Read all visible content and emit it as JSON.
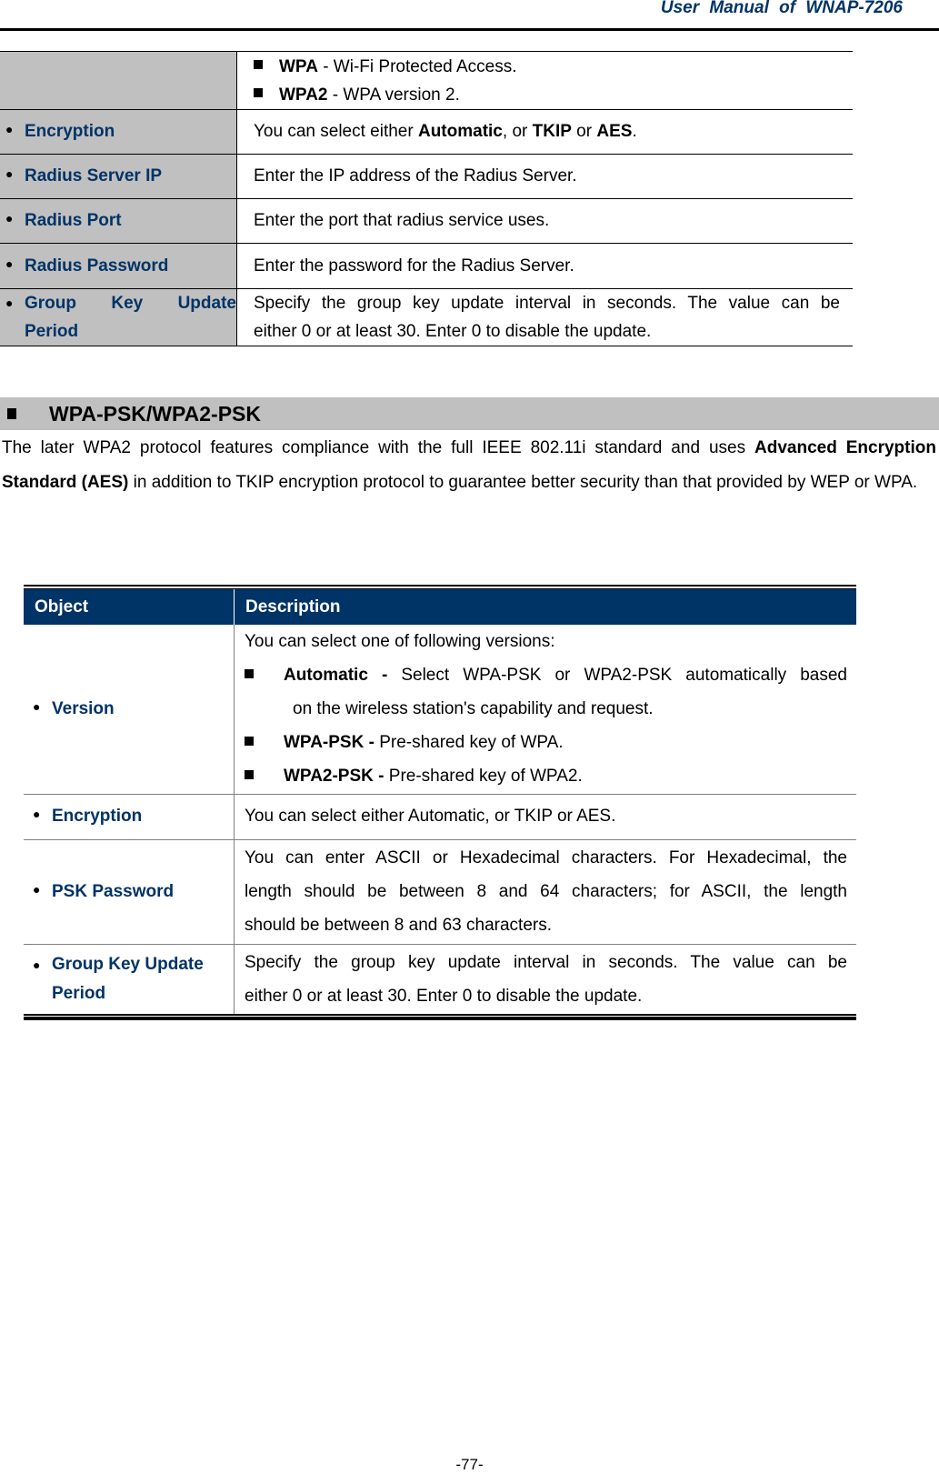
{
  "header": {
    "title": "User  Manual  of  WNAP-7206"
  },
  "top_table": {
    "rows": [
      {
        "object": "",
        "items": [
          {
            "bold": "WPA",
            "text": " - Wi-Fi Protected Access."
          },
          {
            "bold": "WPA2",
            "text": " - WPA version 2."
          }
        ]
      },
      {
        "object": "Encryption",
        "desc_parts": [
          "You can select either ",
          "Automatic",
          ", or ",
          "TKIP",
          " or ",
          "AES",
          "."
        ]
      },
      {
        "object": "Radius Server IP",
        "desc": "Enter the IP address of the Radius Server."
      },
      {
        "object": "Radius Port",
        "desc": "Enter the port that radius service uses."
      },
      {
        "object": "Radius Password",
        "desc": "Enter the password for the Radius Server."
      },
      {
        "object_lines": [
          "Group Key Update",
          "Period"
        ],
        "desc_lines": [
          "Specify the group key update interval in seconds. The value can be",
          "either 0 or at least 30. Enter 0 to disable the update."
        ]
      }
    ]
  },
  "section": {
    "title": "WPA-PSK/WPA2-PSK"
  },
  "paragraph": {
    "part1": "The later WPA2 protocol features compliance with the full IEEE 802.11i standard and uses ",
    "bold": "Advanced Encryption Standard (AES)",
    "part2": " in addition to TKIP encryption protocol to guarantee better security than that provided by WEP or WPA."
  },
  "main_table": {
    "headers": {
      "object": "Object",
      "description": "Description"
    },
    "colors": {
      "header_bg": "#003366",
      "object_text": "#003366"
    },
    "rows": [
      {
        "object": "Version",
        "intro": "You can select one of following versions:",
        "items": [
          {
            "bold": "Automatic - ",
            "text": "Select WPA-PSK or WPA2-PSK automatically based",
            "cont": "on the wireless station's capability and request."
          },
          {
            "bold": "WPA-PSK - ",
            "text": "Pre-shared key of WPA."
          },
          {
            "bold": "WPA2-PSK - ",
            "text": "Pre-shared key of WPA2."
          }
        ]
      },
      {
        "object": "Encryption",
        "desc": "You can select either Automatic, or TKIP or AES."
      },
      {
        "object": "PSK Password",
        "desc_lines": [
          "You can enter ASCII or Hexadecimal characters. For Hexadecimal, the",
          "length should be between 8 and 64 characters; for ASCII, the length",
          "should be between 8 and 63 characters."
        ]
      },
      {
        "object_lines": [
          "Group Key Update",
          "Period"
        ],
        "desc_lines": [
          "Specify the group key update interval in seconds. The value can be",
          "either 0 or at least 30. Enter 0 to disable the update."
        ]
      }
    ]
  },
  "footer": {
    "page_number": "-77-"
  }
}
